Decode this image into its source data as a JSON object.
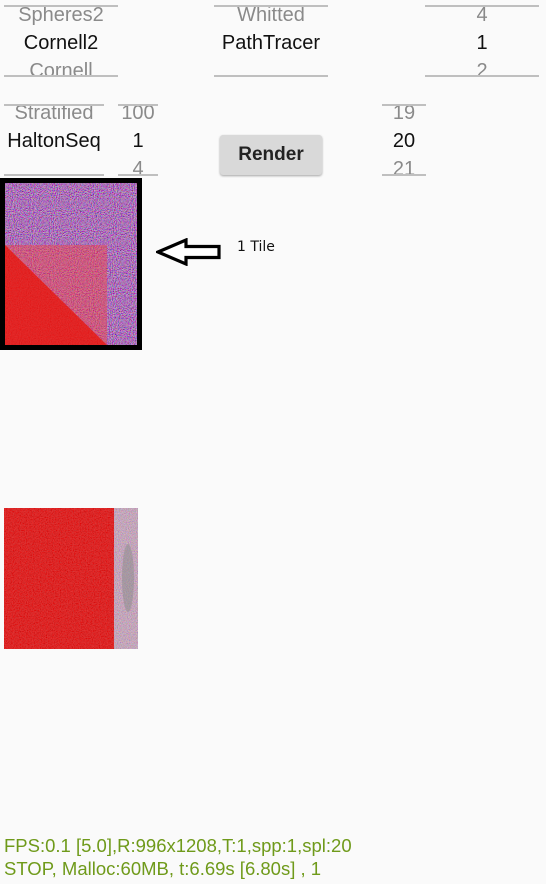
{
  "scene_picker": {
    "options": [
      "Spheres2",
      "Cornell2",
      "Cornell"
    ],
    "selected_index": 1
  },
  "integrator_picker": {
    "options": [
      "Whitted",
      "PathTracer",
      ""
    ],
    "selected_index": 1
  },
  "count_picker": {
    "options": [
      "4",
      "1",
      "2"
    ],
    "selected_index": 1
  },
  "sampler_picker": {
    "options": [
      "Stratified",
      "HaltonSeq",
      ""
    ],
    "selected_index": 1
  },
  "spp_picker": {
    "options": [
      "100",
      "1",
      "4"
    ],
    "selected_index": 1
  },
  "depth_picker": {
    "options": [
      "19",
      "20",
      "21"
    ],
    "selected_index": 1
  },
  "render_button": {
    "label": "Render"
  },
  "annotation": {
    "label": "1 Tile"
  },
  "stats": {
    "line1": "FPS:0.1 [5.0],R:996x1208,T:1,spp:1,spl:20",
    "line2": "STOP, Malloc:60MB, t:6.69s [6.80s] , 1"
  },
  "colors": {
    "stats_text": "#6f9a1a",
    "render_red": "#d40c0c",
    "noise_blue": "#6a6ac8",
    "picker_line": "#bfbfbf"
  }
}
